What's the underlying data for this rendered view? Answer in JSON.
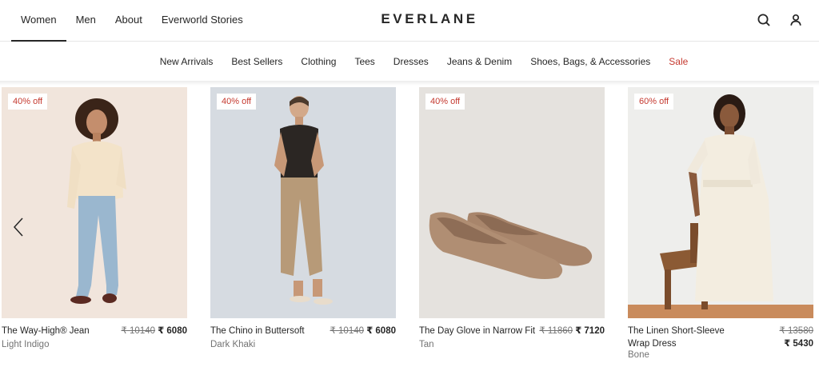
{
  "header": {
    "nav": [
      "Women",
      "Men",
      "About",
      "Everworld Stories"
    ],
    "active": "Women",
    "logo": "EVERLANE",
    "icons": [
      "search-icon",
      "user-icon"
    ]
  },
  "categories": [
    "New Arrivals",
    "Best Sellers",
    "Clothing",
    "Tees",
    "Dresses",
    "Jeans & Denim",
    "Shoes, Bags, & Accessories",
    "Sale"
  ],
  "colors": {
    "sale": "#c5392f",
    "text": "#262626",
    "muted": "#737373"
  },
  "products": [
    {
      "badge": "40% off",
      "name": "The Way-High® Jean",
      "color": "Light Indigo",
      "old_price": "₹ 10140",
      "price": "₹ 6080"
    },
    {
      "badge": "40% off",
      "name": "The Chino in Buttersoft",
      "color": "Dark Khaki",
      "old_price": "₹ 10140",
      "price": "₹ 6080"
    },
    {
      "badge": "40% off",
      "name": "The Day Glove in Narrow Fit",
      "color": "Tan",
      "old_price": "₹ 11860",
      "price": "₹ 7120"
    },
    {
      "badge": "60% off",
      "name": "The Linen Short-Sleeve Wrap Dress",
      "color": "Bone",
      "old_price": "₹ 13580",
      "price": "₹ 5430"
    }
  ],
  "carousel": {
    "prev_icon": "chevron-left-icon"
  }
}
